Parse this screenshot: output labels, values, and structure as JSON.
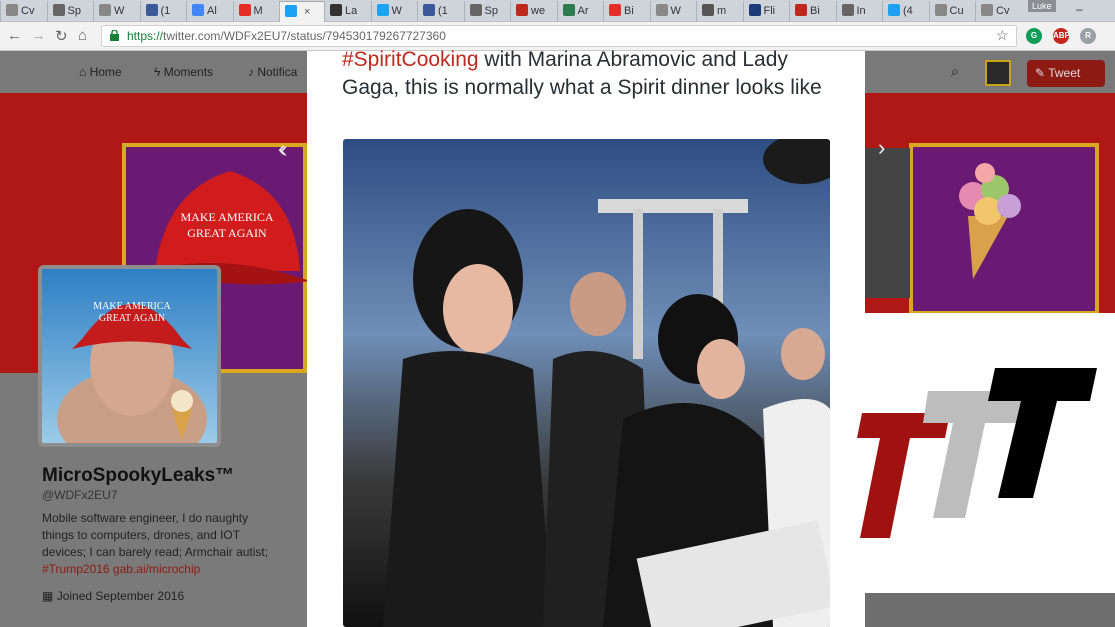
{
  "browser": {
    "tabs": [
      {
        "label": "Cv",
        "icon": "page-icon",
        "color": "#888"
      },
      {
        "label": "Sp",
        "icon": "globe-icon",
        "color": "#666"
      },
      {
        "label": "W",
        "icon": "page-icon",
        "color": "#888"
      },
      {
        "label": "(1",
        "icon": "facebook-icon",
        "color": "#3b5998"
      },
      {
        "label": "Al",
        "icon": "google-icon",
        "color": "#4285f4"
      },
      {
        "label": "M",
        "icon": "youtube-icon",
        "color": "#e52d27"
      },
      {
        "label": "",
        "icon": "twitter-icon",
        "color": "#1da1f2",
        "active": true
      },
      {
        "label": "La",
        "icon": "bookmark-icon",
        "color": "#333"
      },
      {
        "label": "W",
        "icon": "twitter-icon",
        "color": "#1da1f2"
      },
      {
        "label": "(1",
        "icon": "facebook-icon",
        "color": "#3b5998"
      },
      {
        "label": "Sp",
        "icon": "globe-icon",
        "color": "#666"
      },
      {
        "label": "we",
        "icon": "tr-icon",
        "color": "#c0281d"
      },
      {
        "label": "Ar",
        "icon": "h-icon",
        "color": "#2d7b4f"
      },
      {
        "label": "Bi",
        "icon": "youtube-icon",
        "color": "#e52d27"
      },
      {
        "label": "W",
        "icon": "page-icon",
        "color": "#888"
      },
      {
        "label": "m",
        "icon": "grid-icon",
        "color": "#555"
      },
      {
        "label": "Fli",
        "icon": "chart-icon",
        "color": "#1a3a7a"
      },
      {
        "label": "Bi",
        "icon": "drop-icon",
        "color": "#c0281d"
      },
      {
        "label": "In",
        "icon": "globe-icon",
        "color": "#666"
      },
      {
        "label": "(4",
        "icon": "twitter-icon",
        "color": "#1da1f2"
      },
      {
        "label": "Cu",
        "icon": "page-icon",
        "color": "#888"
      },
      {
        "label": "Cv",
        "icon": "page-icon",
        "color": "#888"
      }
    ],
    "user_label": "Luke",
    "url_secure": "https://",
    "url_rest": "twitter.com/WDFx2EU7/status/794530179267727360"
  },
  "twitter_nav": {
    "home": "Home",
    "moments": "Moments",
    "notifications": "Notifica",
    "tweet_button": "Tweet"
  },
  "profile": {
    "name": "MicroSpookyLeaks™",
    "handle": "@WDFx2EU7",
    "bio": "Mobile software engineer, I do naughty things to computers, drones, and IOT devices; I can barely read; Armchair autist;",
    "bio_tags": "#Trump2016 gab.ai/microchip",
    "joined": "Joined September 2016",
    "hat_text_1": "MAKE AMERICA",
    "hat_text_2": "GREAT AGAIN"
  },
  "tweet": {
    "hashtag": "#SpiritCooking",
    "text": " with Marina Abramovic and Lady Gaga, this is normally what a Spirit dinner looks like"
  },
  "colors": {
    "logo_red": "#a0120f",
    "logo_gray": "#bdbdbd",
    "logo_black": "#000000",
    "banner_red": "#b01815",
    "banner_gold": "#d9a81f"
  }
}
